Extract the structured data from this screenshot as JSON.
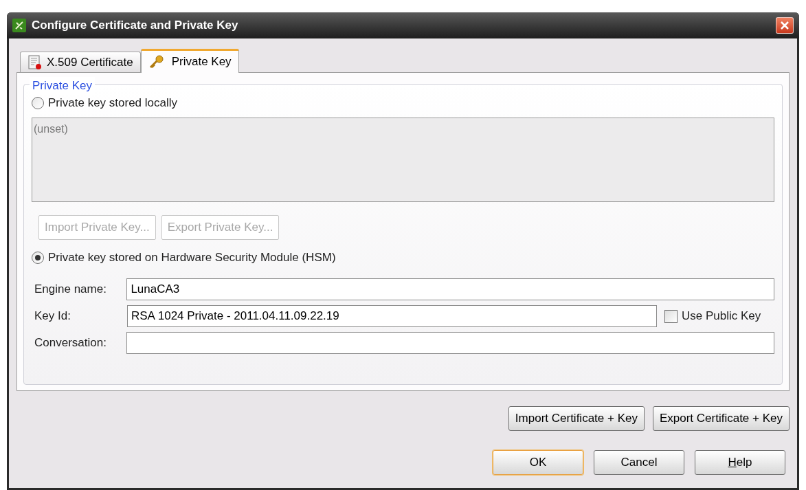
{
  "window": {
    "title": "Configure Certificate and Private Key"
  },
  "tabs": [
    {
      "label": "X.509 Certificate",
      "kind": "certificate",
      "selected": false
    },
    {
      "label": "Private Key",
      "kind": "key",
      "selected": true
    }
  ],
  "group": {
    "title": "Private Key"
  },
  "local_option": {
    "label": "Private key stored locally",
    "selected": false
  },
  "local_key_text": "(unset)",
  "local_buttons": [
    {
      "label": "Import Private Key...",
      "disabled": true
    },
    {
      "label": "Export Private Key...",
      "disabled": true
    }
  ],
  "hsm_option": {
    "label": "Private key stored on Hardware Security Module (HSM)",
    "selected": true
  },
  "fields": [
    {
      "label": "Engine name:",
      "value": "LunaCA3"
    },
    {
      "label": "Key Id:",
      "value": "RSA 1024 Private - 2011.04.11.09.22.19"
    },
    {
      "label": "Conversation:"
    }
  ],
  "use_public_key": {
    "label": "Use Public Key",
    "checked": false
  },
  "cert_buttons": [
    "Import Certificate + Key",
    "Export Certificate + Key"
  ],
  "dialog_buttons": [
    {
      "label": "OK",
      "default": true,
      "mnemonic": false
    },
    {
      "label": "Cancel",
      "default": false,
      "mnemonic": false
    },
    {
      "label": "Help",
      "default": false,
      "mnemonic": true
    }
  ]
}
